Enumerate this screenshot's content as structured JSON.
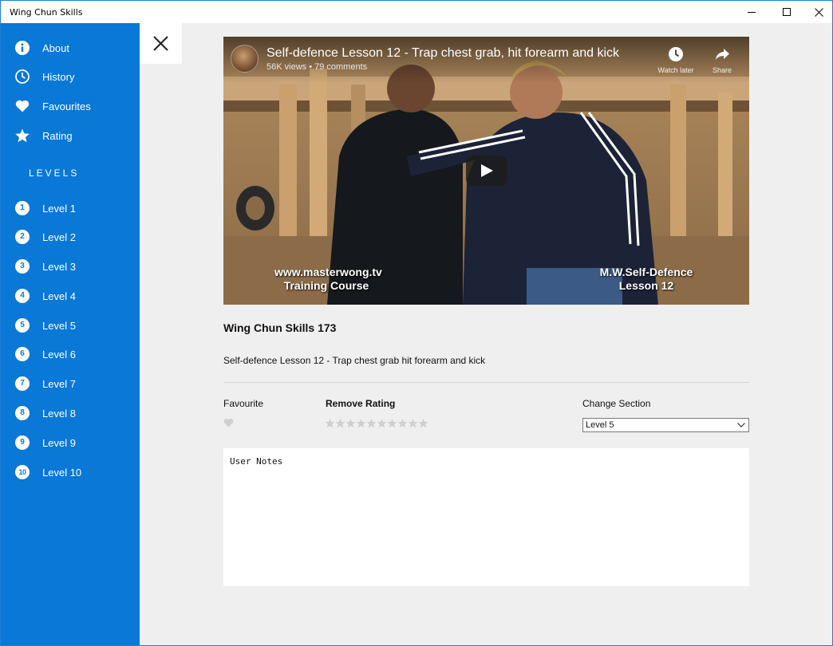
{
  "window": {
    "title": "Wing Chun Skills"
  },
  "sidebar": {
    "menu": [
      {
        "label": "About",
        "icon": "info-icon"
      },
      {
        "label": "History",
        "icon": "clock-icon"
      },
      {
        "label": "Favourites",
        "icon": "heart-icon"
      },
      {
        "label": "Rating",
        "icon": "star-icon"
      }
    ],
    "levels_heading": "LEVELS",
    "levels": [
      {
        "number": "1",
        "label": "Level 1"
      },
      {
        "number": "2",
        "label": "Level 2"
      },
      {
        "number": "3",
        "label": "Level 3"
      },
      {
        "number": "4",
        "label": "Level 4"
      },
      {
        "number": "5",
        "label": "Level 5"
      },
      {
        "number": "6",
        "label": "Level 6"
      },
      {
        "number": "7",
        "label": "Level 7"
      },
      {
        "number": "8",
        "label": "Level 8"
      },
      {
        "number": "9",
        "label": "Level 9"
      },
      {
        "number": "10",
        "label": "Level 10"
      }
    ]
  },
  "video": {
    "title": "Self-defence Lesson 12 - Trap chest grab, hit forearm and kick",
    "meta": "56K views • 79 comments",
    "watch_later": "Watch later",
    "share": "Share",
    "watermark_left_1": "www.masterwong.tv",
    "watermark_left_2": "Training Course",
    "watermark_right_1": "M.W.Self-Defence",
    "watermark_right_2": "Lesson 12"
  },
  "detail": {
    "title": "Wing Chun Skills 173",
    "description": "Self-defence Lesson 12 - Trap chest grab hit forearm and kick",
    "favourite_label": "Favourite",
    "rating_label": "Remove Rating",
    "rating_value": 0,
    "rating_max": 10,
    "section_label": "Change Section",
    "section_value": "Level 5",
    "notes_placeholder": "User Notes"
  },
  "colors": {
    "accent": "#0a78d7",
    "background": "#efefef",
    "inactive_icon": "#cfcfcf"
  }
}
